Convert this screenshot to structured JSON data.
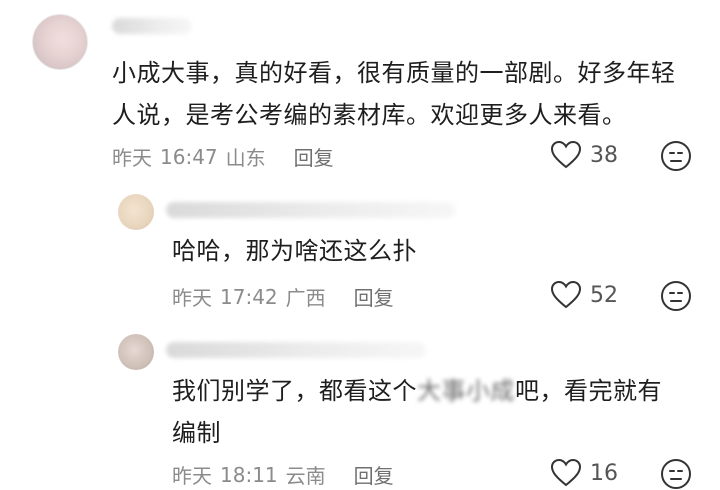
{
  "comments": [
    {
      "text_line1": "小成大事，真的好看，很有质量的一部剧。好多年轻",
      "text_line2": "人说，是考公考编的素材库。欢迎更多人来看。",
      "date": "昨天",
      "time": "16:47",
      "location": "山东",
      "reply_label": "回复",
      "likes": "38"
    },
    {
      "text_line1": "哈哈，那为啥还这么扑",
      "date": "昨天",
      "time": "17:42",
      "location": "广西",
      "reply_label": "回复",
      "likes": "52"
    },
    {
      "text_line1_a": "我们别学了，都看这个",
      "text_line1_blur": "大事小成",
      "text_line1_b": "吧，看完就有",
      "text_line2": "编制",
      "date": "昨天",
      "time": "18:11",
      "location": "云南",
      "reply_label": "回复",
      "likes": "16"
    }
  ],
  "icons": {
    "like": "heart-outline-icon",
    "dislike": "neutral-face-icon"
  },
  "colors": {
    "text": "#1e1e1e",
    "meta": "#8b8b8b",
    "icon": "#333333"
  }
}
